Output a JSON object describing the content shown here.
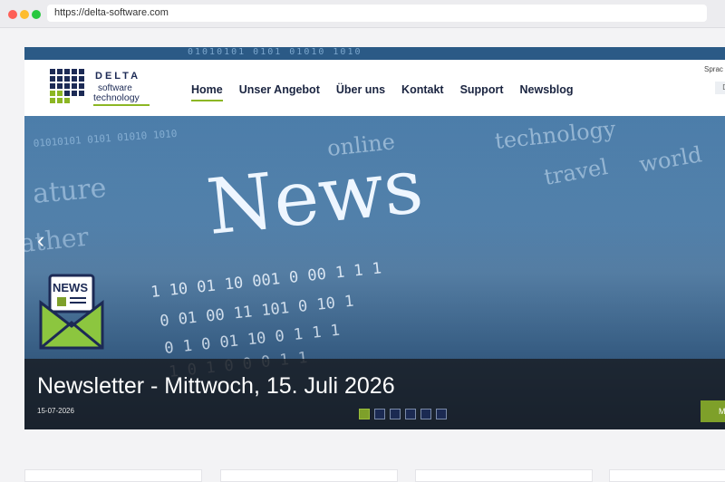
{
  "browser": {
    "url": "https://delta-software.com"
  },
  "logo": {
    "word1": "DELTA",
    "word2": "software",
    "word3": "technology"
  },
  "nav": {
    "items": [
      "Home",
      "Unser Angebot",
      "Über uns",
      "Kontakt",
      "Support",
      "Newsblog"
    ],
    "active": "Home"
  },
  "language": {
    "label": "Sprac",
    "value": "D"
  },
  "hero": {
    "headline_word": "News",
    "bg_words": [
      "online",
      "technology",
      "ature",
      "travel",
      "world",
      "ather"
    ],
    "icon_label": "NEWS",
    "binary_lines": [
      "01010101 0101 01010 1010",
      "1 10 01 10 001   0   00 1   1   1",
      "0 01 00 11 101   0   10 1",
      "0 1 0 01 10 0   1   1 1",
      "1 0 1 0 0 0   1   1"
    ]
  },
  "slider": {
    "title": "Newsletter - Mittwoch, 15. Juli 2026",
    "date": "15-07-2026",
    "dot_count": 6,
    "active_index": 0,
    "more_label": "M"
  },
  "colors": {
    "accent": "#7ea02a",
    "nav_text": "#1a2440",
    "logo_navy": "#1c2a55"
  }
}
